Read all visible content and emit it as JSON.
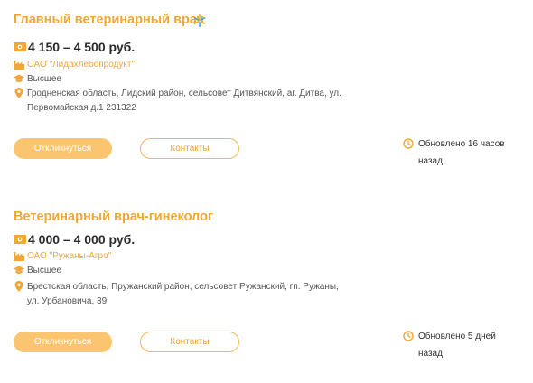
{
  "colors": {
    "accent": "#f0a735",
    "button_fill": "#fbc56f",
    "text": "#333333"
  },
  "vacancies": [
    {
      "title": "Главный ветеринарный врач",
      "salary": "4 150 – 4 500 руб.",
      "company": "ОАО \"Лидахлебопродукт\"",
      "education": "Высшее",
      "address": "Гродненская область, Лидский район, сельсовет Дитвянский, аг. Дитва, ул. Первомайская д.1 231322",
      "apply_label": "Откликнуться",
      "contacts_label": "Контакты",
      "updated_line1": "Обновлено 16 часов",
      "updated_line2": "назад",
      "icons": [
        "money-icon",
        "factory-icon",
        "graduation-cap-icon",
        "map-pin-icon",
        "clock-icon",
        "star-badge-icon"
      ]
    },
    {
      "title": "Ветеринарный врач-гинеколог",
      "salary": "4 000 – 4 000 руб.",
      "company": "ОАО \"Ружаны-Агро\"",
      "education": "Высшее",
      "address": "Брестская область, Пружанский район, сельсовет Ружанский, гп. Ружаны, ул. Урбановича, 39",
      "apply_label": "Откликнуться",
      "contacts_label": "Контакты",
      "updated_line1": "Обновлено 5 дней",
      "updated_line2": "назад",
      "icons": [
        "money-icon",
        "factory-icon",
        "graduation-cap-icon",
        "map-pin-icon",
        "clock-icon"
      ]
    }
  ]
}
